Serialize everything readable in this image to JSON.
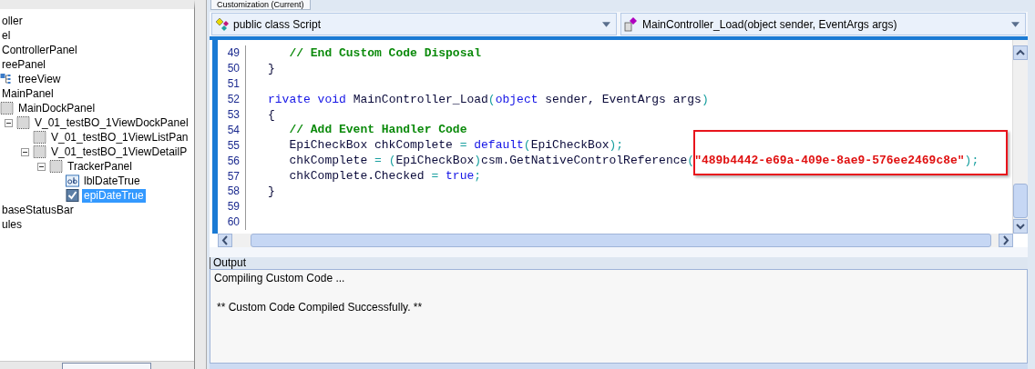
{
  "tree": [
    {
      "label": "oller"
    },
    {
      "label": "el"
    },
    {
      "label": "ControllerPanel"
    },
    {
      "label": "reePanel",
      "children": [
        {
          "label": "treeView",
          "kind": "tree"
        }
      ]
    },
    {
      "label": "MainPanel",
      "children": [
        {
          "label": "MainDockPanel",
          "kind": "panel",
          "children": [
            {
              "label": "V_01_testBO_1ViewDockPanel",
              "kind": "panel",
              "expanded": true,
              "children": [
                {
                  "label": "V_01_testBO_1ViewListPan",
                  "kind": "panel"
                },
                {
                  "label": "V_01_testBO_1ViewDetailP",
                  "kind": "panel",
                  "expanded": true,
                  "children": [
                    {
                      "label": "TrackerPanel",
                      "kind": "panel",
                      "expanded": true,
                      "children": [
                        {
                          "label": "lblDateTrue",
                          "kind": "label",
                          "selected": false
                        },
                        {
                          "label": "epiDateTrue",
                          "kind": "checkbox",
                          "selected": true
                        }
                      ]
                    }
                  ]
                }
              ]
            }
          ]
        }
      ]
    },
    {
      "label": "baseStatusBar"
    },
    {
      "label": "ules"
    }
  ],
  "editor_tab": {
    "label": "Customization (Current)"
  },
  "class_dropdown": {
    "value": "public class Script"
  },
  "member_dropdown": {
    "value": "MainController_Load(object sender, EventArgs args)"
  },
  "code_lines": [
    {
      "number": "49",
      "tokens": [
        {
          "kind": "comment",
          "text": "   // End Custom Code Disposal"
        }
      ]
    },
    {
      "number": "50",
      "tokens": [
        {
          "kind": "text",
          "text": "}"
        }
      ]
    },
    {
      "number": "51"
    },
    {
      "number": "52",
      "tokens": [
        {
          "kind": "keyword",
          "text": "rivate void"
        },
        {
          "kind": "text",
          "text": " MainController_Load"
        },
        {
          "kind": "punct",
          "text": "("
        },
        {
          "kind": "keyword",
          "text": "object"
        },
        {
          "kind": "text",
          "text": " sender, EventArgs args"
        },
        {
          "kind": "punct",
          "text": ")"
        }
      ]
    },
    {
      "number": "53",
      "tokens": [
        {
          "kind": "text",
          "text": "{"
        }
      ]
    },
    {
      "number": "54",
      "tokens": [
        {
          "kind": "comment",
          "text": "   // Add Event Handler Code"
        }
      ]
    },
    {
      "number": "55",
      "tokens": [
        {
          "kind": "text",
          "text": "   EpiCheckBox chkComplete "
        },
        {
          "kind": "punct",
          "text": "= "
        },
        {
          "kind": "keyword",
          "text": "default"
        },
        {
          "kind": "punct",
          "text": "("
        },
        {
          "kind": "text",
          "text": "EpiCheckBox"
        },
        {
          "kind": "punct",
          "text": ");"
        }
      ]
    },
    {
      "number": "56",
      "tokens": [
        {
          "kind": "text",
          "text": "   chkComplete "
        },
        {
          "kind": "punct",
          "text": "= ("
        },
        {
          "kind": "text",
          "text": "EpiCheckBox"
        },
        {
          "kind": "punct",
          "text": ")"
        },
        {
          "kind": "text",
          "text": "csm.GetNativeControlReference"
        },
        {
          "kind": "punct",
          "text": "("
        },
        {
          "kind": "string",
          "text": "\"489b4442-e69a-409e-8ae9-576ee2469c8e\""
        },
        {
          "kind": "punct",
          "text": ");"
        }
      ]
    },
    {
      "number": "57",
      "tokens": [
        {
          "kind": "text",
          "text": "   chkComplete.Checked "
        },
        {
          "kind": "punct",
          "text": "= "
        },
        {
          "kind": "keyword",
          "text": "true"
        },
        {
          "kind": "punct",
          "text": ";"
        }
      ]
    },
    {
      "number": "58",
      "tokens": [
        {
          "kind": "text",
          "text": "}"
        }
      ]
    },
    {
      "number": "59"
    },
    {
      "number": "60"
    }
  ],
  "output": {
    "title": "Output",
    "lines": [
      "Compiling Custom Code ...",
      "** Custom Code Compiled Successfully. **"
    ]
  }
}
